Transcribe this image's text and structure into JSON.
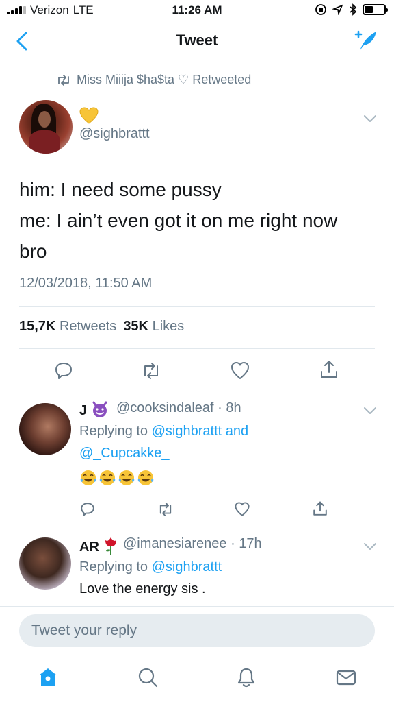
{
  "status_bar": {
    "carrier": "Verizon",
    "network": "LTE",
    "time": "11:26 AM"
  },
  "nav": {
    "title": "Tweet"
  },
  "main_tweet": {
    "retweeted_by": "Miss Miiija $ha$ta ♡ Retweeted",
    "author_emoji": "yellow-heart-emoji",
    "handle": "@sighbrattt",
    "text_lines": [
      "him: I need some pussy",
      "me: I ain’t even got it on me right now",
      "bro"
    ],
    "date": "12/03/2018, 11:50 AM",
    "retweets_count": "15,7K",
    "retweets_label": "Retweets",
    "likes_count": "35K",
    "likes_label": "Likes"
  },
  "replies": [
    {
      "name": "J",
      "name_emoji": "smiling-devil-emoji",
      "handle": "@cooksindaleaf",
      "time": "· 8h",
      "replying_prefix": "Replying to",
      "replying_user1": "@sighbrattt",
      "replying_and": "and",
      "replying_user2": "@_Cupcakke_",
      "emoji_count": 4
    },
    {
      "name": "AR",
      "name_emoji": "rose-emoji",
      "handle": "@imanesiarenee",
      "time": "· 17h",
      "replying_prefix": "Replying to",
      "replying_user1": "@sighbrattt",
      "text": "Love the energy sis ."
    }
  ],
  "reply_box": {
    "placeholder": "Tweet your reply"
  },
  "colors": {
    "accent": "#1da1f2",
    "muted": "#657786",
    "text": "#14171a",
    "divider": "#e1e8ed"
  }
}
